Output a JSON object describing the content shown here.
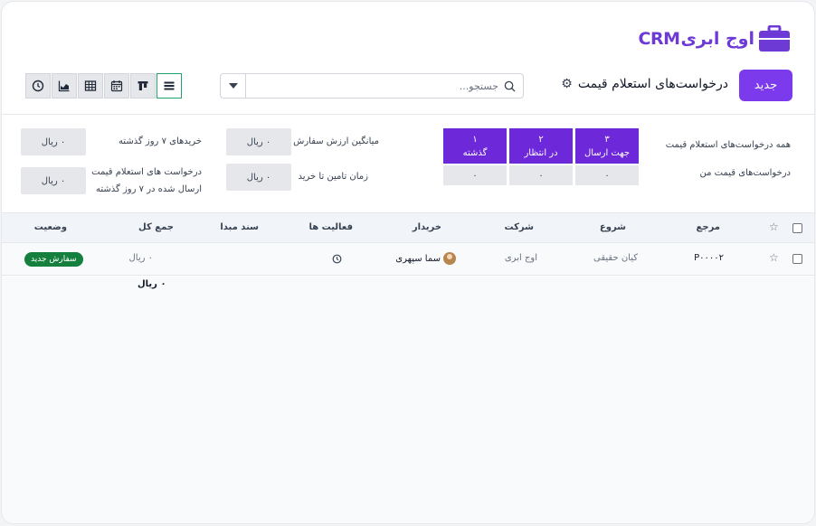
{
  "brand": {
    "logo_text_fa": "اوج ابری",
    "logo_text_en": "CRM",
    "accent": "#7c3aed"
  },
  "toolbar": {
    "new_label": "جدید",
    "title": "درخواست‌های استعلام قیمت",
    "search_placeholder": "جستجو..."
  },
  "views": [
    "list-view",
    "kanban-view",
    "calendar-view",
    "pivot-view",
    "graph-view",
    "activity-view"
  ],
  "stats": {
    "all_rfqs_label": "همه درخواست‌های استعلام قیمت",
    "my_rfqs_label": "درخواست‌های قیمت من",
    "kpis": [
      {
        "count": "۳",
        "label": "جهت ارسال",
        "value": "۰"
      },
      {
        "count": "۲",
        "label": "در انتظار",
        "value": "۰"
      },
      {
        "count": "۱",
        "label": "گذشته",
        "value": "۰"
      }
    ],
    "avg_order_label": "میانگین ارزش سفارش",
    "avg_order_value": "۰ ریال",
    "lead_time_label": "زمان تامین تا خرید",
    "lead_time_value": "۰ ریال",
    "purchases_7d_label": "خریدهای ۷ روز گذشته",
    "purchases_7d_value": "۰ ریال",
    "rfq_sent_7d_label_1": "درخواست های استعلام قیمت",
    "rfq_sent_7d_label_2": "ارسال شده در ۷ روز گذشته",
    "rfq_sent_7d_value": "۰ ریال"
  },
  "table": {
    "columns": [
      "مرجع",
      "شروع",
      "شرکت",
      "خریدار",
      "فعالیت ها",
      "سند مبدا",
      "جمع کل",
      "وضعیت"
    ],
    "rows": [
      {
        "reference": "P۰۰۰۰۲",
        "start": "کیان حقیقی",
        "company": "اوج ابری",
        "buyer": "سما سپهری",
        "total": "۰ ریال",
        "status": "سفارش جدید"
      }
    ],
    "grand_total": "۰ ریال"
  }
}
